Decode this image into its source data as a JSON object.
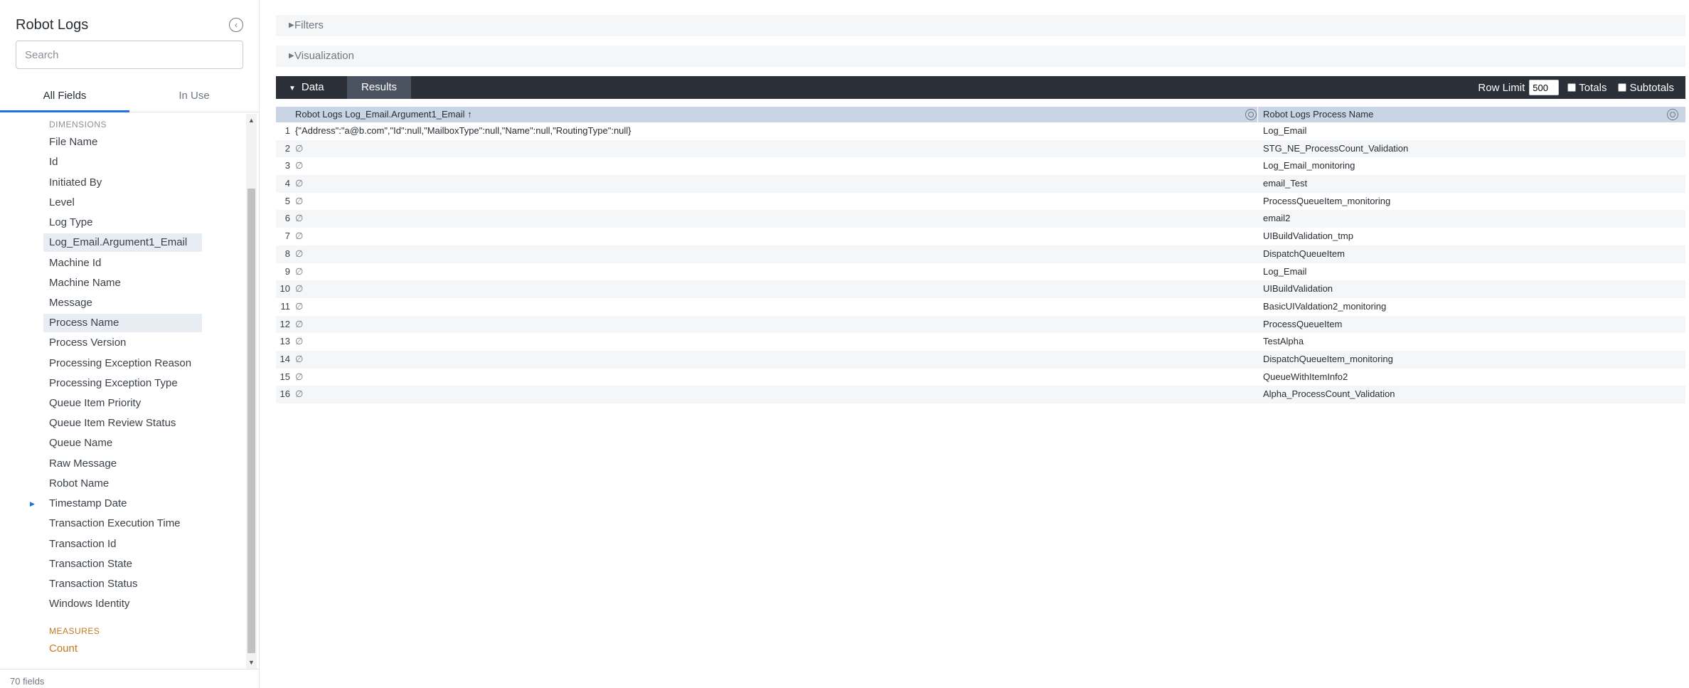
{
  "sidebar": {
    "title": "Robot Logs",
    "search_placeholder": "Search",
    "tabs": [
      "All Fields",
      "In Use"
    ],
    "dimensions_label": "DIMENSIONS",
    "dimensions": [
      "File Name",
      "Id",
      "Initiated By",
      "Level",
      "Log Type",
      "Log_Email.Argument1_Email",
      "Machine Id",
      "Machine Name",
      "Message",
      "Process Name",
      "Process Version",
      "Processing Exception Reason",
      "Processing Exception Type",
      "Queue Item Priority",
      "Queue Item Review Status",
      "Queue Name",
      "Raw Message",
      "Robot Name",
      "Timestamp Date",
      "Transaction Execution Time",
      "Transaction Id",
      "Transaction State",
      "Transaction Status",
      "Windows Identity"
    ],
    "measures_label": "MEASURES",
    "measures": [
      "Count"
    ],
    "field_count": "70 fields"
  },
  "panels": {
    "filters": "Filters",
    "visualization": "Visualization"
  },
  "databar": {
    "data_tab": "Data",
    "results_tab": "Results",
    "row_limit_label": "Row Limit",
    "row_limit_value": "500",
    "totals_label": "Totals",
    "subtotals_label": "Subtotals"
  },
  "table": {
    "col1": "Robot Logs Log_Email.Argument1_Email ↑",
    "col2": "Robot Logs Process Name",
    "rows": [
      [
        "1",
        "{\"Address\":\"a@b.com\",\"Id\":null,\"MailboxType\":null,\"Name\":null,\"RoutingType\":null}",
        "Log_Email"
      ],
      [
        "2",
        "∅",
        "STG_NE_ProcessCount_Validation"
      ],
      [
        "3",
        "∅",
        "Log_Email_monitoring"
      ],
      [
        "4",
        "∅",
        "email_Test"
      ],
      [
        "5",
        "∅",
        "ProcessQueueItem_monitoring"
      ],
      [
        "6",
        "∅",
        "email2"
      ],
      [
        "7",
        "∅",
        "UIBuildValidation_tmp"
      ],
      [
        "8",
        "∅",
        "DispatchQueueItem"
      ],
      [
        "9",
        "∅",
        "Log_Email"
      ],
      [
        "10",
        "∅",
        "UIBuildValidation"
      ],
      [
        "11",
        "∅",
        "BasicUIValdation2_monitoring"
      ],
      [
        "12",
        "∅",
        "ProcessQueueItem"
      ],
      [
        "13",
        "∅",
        "TestAlpha"
      ],
      [
        "14",
        "∅",
        "DispatchQueueItem_monitoring"
      ],
      [
        "15",
        "∅",
        "QueueWithItemInfo2"
      ],
      [
        "16",
        "∅",
        "Alpha_ProcessCount_Validation"
      ]
    ]
  },
  "colors": {
    "accent": "#1a73e8",
    "measure": "#c27a1f",
    "header_bg": "#c9d5e5",
    "databar_bg": "#2a2f38"
  }
}
